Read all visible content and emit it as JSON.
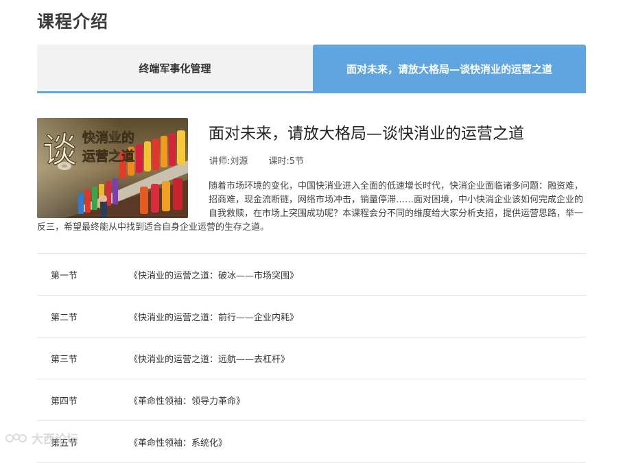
{
  "section": {
    "title": "课程介绍"
  },
  "tabs": [
    {
      "label": "终端军事化管理",
      "active": false
    },
    {
      "label": "面对未来，请放大格局—谈快消业的运营之道",
      "active": true
    }
  ],
  "course": {
    "image_alt": "谈 快消业的 运营之道",
    "image_text_big": "谈",
    "image_text_line1": "快消业的",
    "image_text_line2": "运营之道",
    "title": "面对未来，请放大格局—谈快消业的运营之道",
    "lecturer": "讲师:刘源",
    "hours": "课时:5节",
    "description": "随着市场环境的变化，中国快消业进入全面的低速增长时代，快消企业面临诸多问题：融资难，招商难，现金流断链，网络市场冲击，销量停滞……面对困境，中小快消企业该如何完成企业的自我救赎，在市场上突围成功呢？本课程会分不同的维度给大家分析支招，提供运营思路，举一反三，希望最终能从中找到适合自身企业运营的生存之道。"
  },
  "lessons": [
    {
      "num": "第一节",
      "name": "《快消业的运营之道：破冰——市场突围》"
    },
    {
      "num": "第二节",
      "name": "《快消业的运营之道：前行——企业内耗》"
    },
    {
      "num": "第三节",
      "name": "《快消业的运营之道：远航——去杠杆》"
    },
    {
      "num": "第四节",
      "name": "《革命性领袖：领导力革命》"
    },
    {
      "num": "第五节",
      "name": "《革命性领袖：系统化》"
    }
  ],
  "watermark": {
    "text": "大西论坛"
  },
  "colors": {
    "accent": "#5fa5e0",
    "tab_inactive_bg": "#f2f2f2",
    "divider": "#e3e3e3"
  }
}
